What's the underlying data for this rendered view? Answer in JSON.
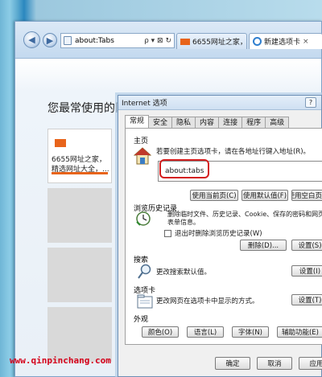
{
  "browser": {
    "address": "about:Tabs",
    "address_controls": "ρ ▾ ⊠ ↻",
    "tabs": [
      {
        "label": "6655网址之家，..."
      },
      {
        "label": "新建选项卡"
      }
    ],
    "tab_close": "×"
  },
  "page": {
    "heading": "您最常使用的网站",
    "tile1_text_line1": "6655网址之家，",
    "tile1_text_line2": "精选网址大全，..."
  },
  "dialog": {
    "title": "Internet 选项",
    "help": "?",
    "tabs": [
      "常规",
      "安全",
      "隐私",
      "内容",
      "连接",
      "程序",
      "高级"
    ],
    "home": {
      "section": "主页",
      "description": "若要创建主页选项卡，请在各地址行键入地址(R)。",
      "value": "about:tabs",
      "buttons": [
        "使用当前页(C)",
        "使用默认值(F)",
        "使用空白页(B)"
      ]
    },
    "history": {
      "section": "浏览历史记录",
      "description": "删除临时文件、历史记录、Cookie、保存的密码和网页表单信息。",
      "checkbox": "退出时删除浏览历史记录(W)",
      "delete_button": "删除(D)...",
      "settings_button": "设置(S)"
    },
    "search": {
      "section": "搜索",
      "description": "更改搜索默认值。",
      "settings_button": "设置(I)"
    },
    "tabs_section": {
      "section": "选项卡",
      "description": "更改网页在选项卡中显示的方式。",
      "settings_button": "设置(T)"
    },
    "appearance": {
      "section": "外观",
      "buttons": [
        "颜色(O)",
        "语言(L)",
        "字体(N)",
        "辅助功能(E)"
      ]
    },
    "footer": {
      "ok": "确定",
      "cancel": "取消",
      "apply": "应用"
    }
  },
  "watermark": "www.qinpinchang.com",
  "colors": {
    "brand_orange": "#e8641b",
    "highlight_red": "#d41e1e",
    "watermark_red": "#d4001a"
  }
}
